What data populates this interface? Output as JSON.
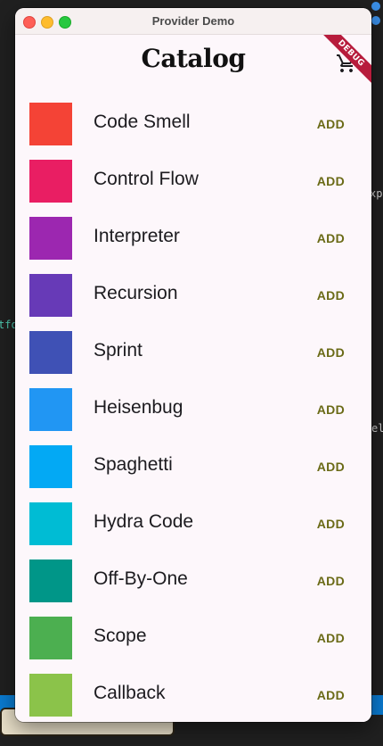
{
  "window": {
    "title": "Provider Demo"
  },
  "appbar": {
    "title": "Catalog"
  },
  "debug_banner": "DEBUG",
  "catalog": {
    "add_label": "ADD",
    "items": [
      {
        "name": "Code Smell",
        "color": "#f44336"
      },
      {
        "name": "Control Flow",
        "color": "#e91e63"
      },
      {
        "name": "Interpreter",
        "color": "#9c27b0"
      },
      {
        "name": "Recursion",
        "color": "#673ab7"
      },
      {
        "name": "Sprint",
        "color": "#3f51b5"
      },
      {
        "name": "Heisenbug",
        "color": "#2196f3"
      },
      {
        "name": "Spaghetti",
        "color": "#03a9f4"
      },
      {
        "name": "Hydra Code",
        "color": "#00bcd4"
      },
      {
        "name": "Off-By-One",
        "color": "#009688"
      },
      {
        "name": "Scope",
        "color": "#4caf50"
      },
      {
        "name": "Callback",
        "color": "#8bc34a"
      }
    ]
  },
  "icons": {
    "cart": "shopping-cart-icon"
  },
  "background": {
    "code_left": "tfo",
    "code_right_a": "xp",
    "code_right_b": "ele"
  }
}
